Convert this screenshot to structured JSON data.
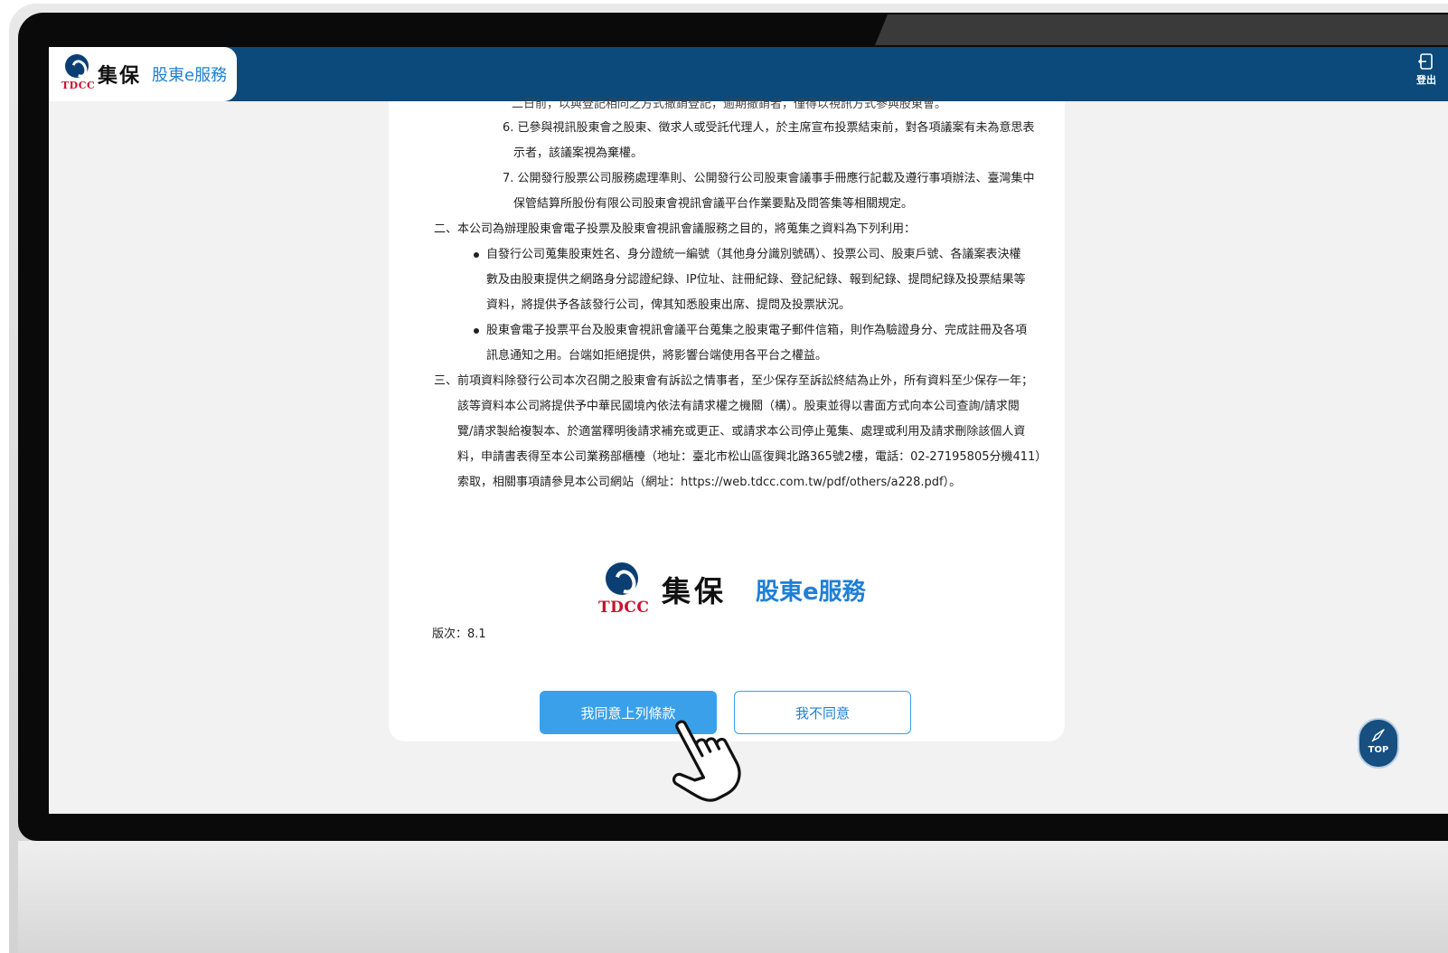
{
  "header": {
    "logo_mark_text": "TDCC",
    "brand_cjk": "集保",
    "brand_service": "股東e服務",
    "logout_label": "登出",
    "logout_icon": "logout-icon"
  },
  "terms": {
    "cut_line": "二日前，以與登記相同之方式撤銷登記，逾期撤銷者，僅得以視訊方式參與股東會。",
    "item6_l1": "6. 已參與視訊股東會之股東、徵求人或受託代理人，於主席宣布投票結束前，對各項議案有未為意思表",
    "item6_l2": "示者，該議案視為棄權。",
    "item7_l1": "7. 公開發行股票公司服務處理準則、公開發行公司股東會議事手冊應行記載及遵行事項辦法、臺灣集中",
    "item7_l2": "保管結算所股份有限公司股東會視訊會議平台作業要點及問答集等相關規定。",
    "sec2": "二、本公司為辦理股東會電子投票及股東會視訊會議服務之目的，將蒐集之資料為下列利用：",
    "b1_l1": "自發行公司蒐集股東姓名、身分證統一編號（其他身分識別號碼）、投票公司、股東戶號、各議案表決權",
    "b1_l2": "數及由股東提供之網路身分認證紀錄、IP位址、註冊紀錄、登記紀錄、報到紀錄、提問紀錄及投票結果等",
    "b1_l3": "資料，將提供予各該發行公司，俾其知悉股東出席、提問及投票狀況。",
    "b2_l1": "股東會電子投票平台及股東會視訊會議平台蒐集之股東電子郵件信箱，則作為驗證身分、完成註冊及各項",
    "b2_l2": "訊息通知之用。台端如拒絕提供，將影響台端使用各平台之權益。",
    "sec3_l1": "三、前項資料除發行公司本次召開之股東會有訴訟之情事者，至少保存至訴訟終結為止外，所有資料至少保存一年；",
    "sec3_l2": "該等資料本公司將提供予中華民國境內依法有請求權之機關（構）。股東並得以書面方式向本公司查詢/請求閱",
    "sec3_l3": "覽/請求製給複製本、於適當釋明後請求補充或更正、或請求本公司停止蒐集、處理或利用及請求刪除該個人資",
    "sec3_l4": "料，申請書表得至本公司業務部櫃檯（地址：臺北市松山區復興北路365號2樓，電話：02-27195805分機411）",
    "sec3_l5": "索取，相關事項請參見本公司網站（網址：https://web.tdcc.com.tw/pdf/others/a228.pdf）。"
  },
  "footer_logo": {
    "mark_text": "TDCC",
    "brand_cjk": "集保",
    "brand_service": "股東e服務"
  },
  "version": "版次：8.1",
  "buttons": {
    "agree": "我同意上列條款",
    "disagree": "我不同意"
  },
  "top_button": {
    "label": "TOP",
    "icon": "rocket-icon"
  },
  "colors": {
    "topbar": "#0b4a7a",
    "accent": "#3aa0ea",
    "link_blue": "#1f7fd6",
    "tdcc_red": "#c8102e"
  }
}
